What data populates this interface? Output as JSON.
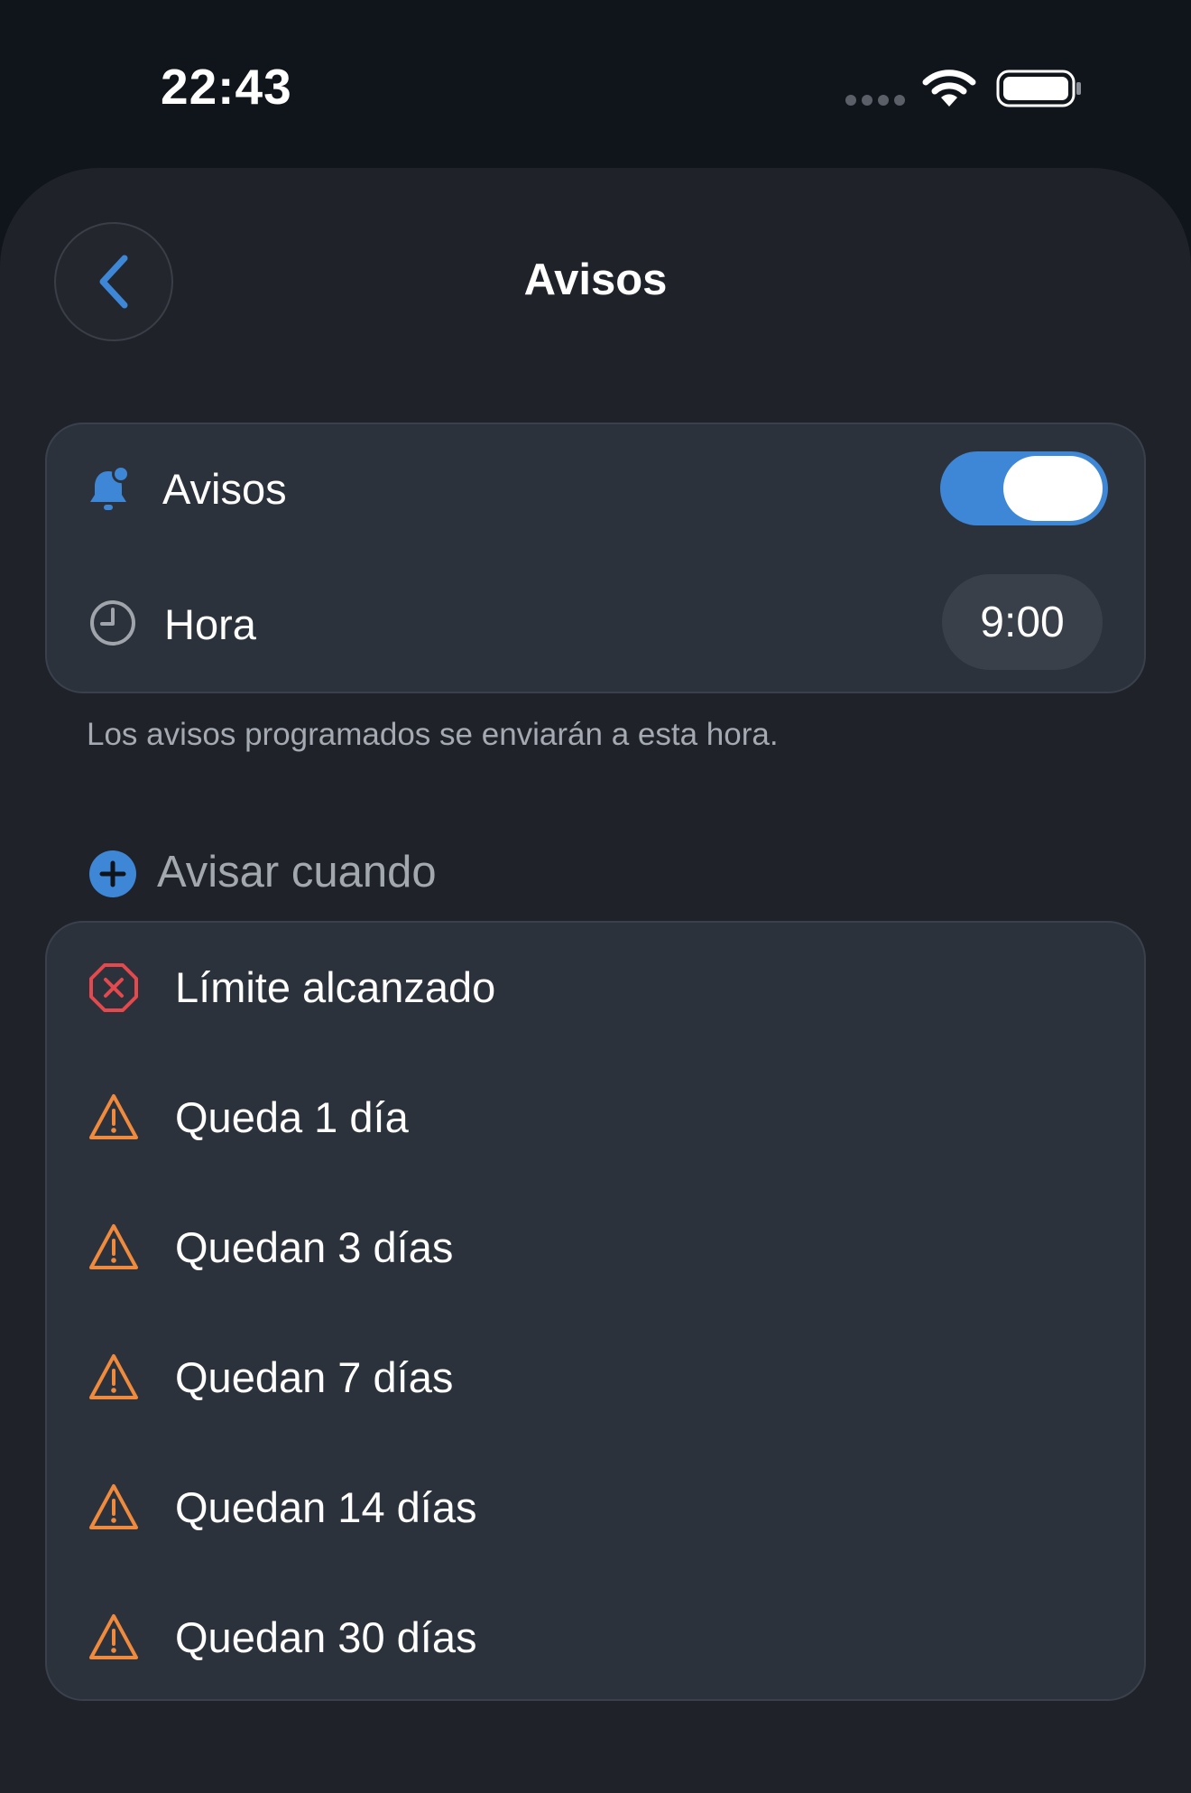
{
  "status_bar": {
    "time": "22:43",
    "icons": [
      "signal-dots-icon",
      "wifi-icon",
      "battery-icon"
    ]
  },
  "header": {
    "title": "Avisos",
    "back_icon": "chevron-left-icon"
  },
  "settings": {
    "notifications": {
      "label": "Avisos",
      "icon": "bell-badge-icon",
      "enabled": true
    },
    "time": {
      "label": "Hora",
      "icon": "clock-icon",
      "value": "9:00"
    },
    "footnote": "Los avisos programados se enviarán a esta hora."
  },
  "alerts_section": {
    "header": "Avisar cuando",
    "header_icon": "plus-circle-icon",
    "items": [
      {
        "label": "Límite alcanzado",
        "icon": "x-octagon-icon"
      },
      {
        "label": "Queda 1 día",
        "icon": "warning-triangle-icon"
      },
      {
        "label": "Quedan 3 días",
        "icon": "warning-triangle-icon"
      },
      {
        "label": "Quedan 7 días",
        "icon": "warning-triangle-icon"
      },
      {
        "label": "Quedan 14 días",
        "icon": "warning-triangle-icon"
      },
      {
        "label": "Quedan 30 días",
        "icon": "warning-triangle-icon"
      }
    ]
  },
  "colors": {
    "accent": "#3e86d6",
    "danger": "#e5484d",
    "warning": "#f08a3c",
    "background": "#10141b",
    "sheet": "#1f2229",
    "card": "#2c323c"
  }
}
